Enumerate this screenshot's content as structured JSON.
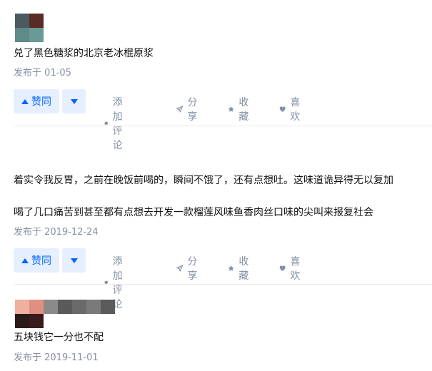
{
  "actions": {
    "upvote": "赞同",
    "comment": "添加评论",
    "share": "分享",
    "favorite": "收藏",
    "like": "喜欢"
  },
  "colors": {
    "accent": "#0066ff",
    "muted": "#8590a6",
    "vote_bg": "rgba(0,102,255,0.1)"
  },
  "answers": [
    {
      "avatar_pixels": [
        "#4a5a60",
        "#5a2a24",
        "#5e8a88",
        "#6a9a98"
      ],
      "paragraphs": [
        "兑了黑色糖浆的北京老冰棍原浆"
      ],
      "date": "发布于 01-05"
    },
    {
      "paragraphs": [
        "着实令我反胃，之前在晚饭前喝的，瞬间不饿了，还有点想吐。这味道诡异得无以复加",
        "喝了几口痛苦到甚至都有点想去开发一款榴莲风味鱼香肉丝口味的尖叫来报复社会"
      ],
      "date": "发布于 2019-12-24"
    },
    {
      "avatar_pixels": [
        "#f0b0a0",
        "#e09080",
        "#8a8a8a",
        "#5a5a5a",
        "#6a6a6a",
        "#7a7a7a",
        "#5a5a5a",
        "#2a1a1a",
        "#3a1a1a"
      ],
      "paragraphs": [
        "五块钱它一分也不配"
      ],
      "date": "发布于 2019-11-01"
    }
  ]
}
